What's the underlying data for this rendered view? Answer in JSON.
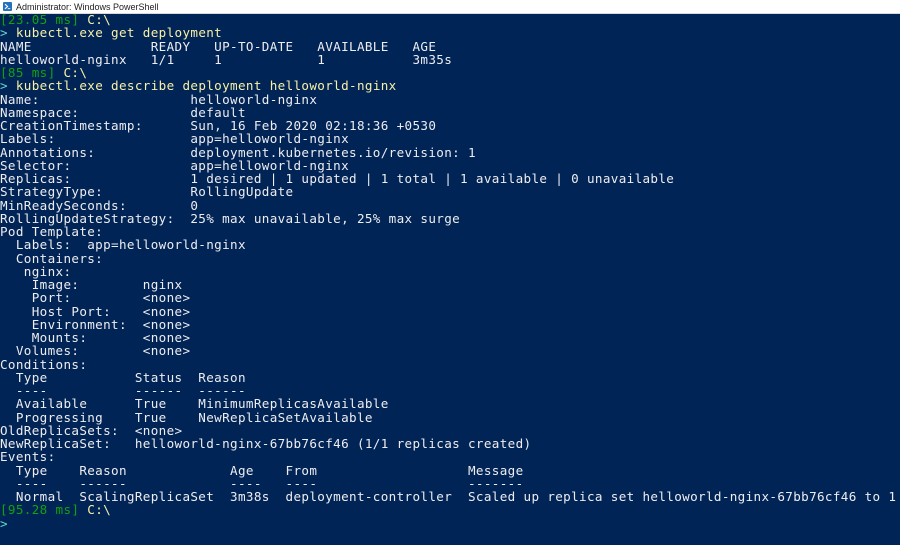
{
  "window": {
    "title": "Administrator: Windows PowerShell"
  },
  "colors": {
    "background": "#012456",
    "foreground": "#eeedf0",
    "timing": "#13a10e",
    "path": "#f9f1a5",
    "command": "#f9f1a5",
    "chevron": "#61d6d6"
  },
  "terminal": {
    "lines": [
      {
        "type": "prompt",
        "time": "[23.05 ms]",
        "path": "C:\\"
      },
      {
        "type": "command",
        "chevron": ">",
        "text": "kubectl.exe get deployment"
      },
      {
        "type": "output",
        "text": "NAME               READY   UP-TO-DATE   AVAILABLE   AGE"
      },
      {
        "type": "output",
        "text": "helloworld-nginx   1/1     1            1           3m35s"
      },
      {
        "type": "prompt",
        "time": "[85 ms]",
        "path": "C:\\"
      },
      {
        "type": "command",
        "chevron": ">",
        "text": "kubectl.exe describe deployment helloworld-nginx"
      },
      {
        "type": "output",
        "text": "Name:                   helloworld-nginx"
      },
      {
        "type": "output",
        "text": "Namespace:              default"
      },
      {
        "type": "output",
        "text": "CreationTimestamp:      Sun, 16 Feb 2020 02:18:36 +0530"
      },
      {
        "type": "output",
        "text": "Labels:                 app=helloworld-nginx"
      },
      {
        "type": "output",
        "text": "Annotations:            deployment.kubernetes.io/revision: 1"
      },
      {
        "type": "output",
        "text": "Selector:               app=helloworld-nginx"
      },
      {
        "type": "output",
        "text": "Replicas:               1 desired | 1 updated | 1 total | 1 available | 0 unavailable"
      },
      {
        "type": "output",
        "text": "StrategyType:           RollingUpdate"
      },
      {
        "type": "output",
        "text": "MinReadySeconds:        0"
      },
      {
        "type": "output",
        "text": "RollingUpdateStrategy:  25% max unavailable, 25% max surge"
      },
      {
        "type": "output",
        "text": "Pod Template:"
      },
      {
        "type": "output",
        "text": "  Labels:  app=helloworld-nginx"
      },
      {
        "type": "output",
        "text": "  Containers:"
      },
      {
        "type": "output",
        "text": "   nginx:"
      },
      {
        "type": "output",
        "text": "    Image:        nginx"
      },
      {
        "type": "output",
        "text": "    Port:         <none>"
      },
      {
        "type": "output",
        "text": "    Host Port:    <none>"
      },
      {
        "type": "output",
        "text": "    Environment:  <none>"
      },
      {
        "type": "output",
        "text": "    Mounts:       <none>"
      },
      {
        "type": "output",
        "text": "  Volumes:        <none>"
      },
      {
        "type": "output",
        "text": "Conditions:"
      },
      {
        "type": "output",
        "text": "  Type           Status  Reason"
      },
      {
        "type": "output",
        "text": "  ----           ------  ------"
      },
      {
        "type": "output",
        "text": "  Available      True    MinimumReplicasAvailable"
      },
      {
        "type": "output",
        "text": "  Progressing    True    NewReplicaSetAvailable"
      },
      {
        "type": "output",
        "text": "OldReplicaSets:  <none>"
      },
      {
        "type": "output",
        "text": "NewReplicaSet:   helloworld-nginx-67bb76cf46 (1/1 replicas created)"
      },
      {
        "type": "output",
        "text": "Events:"
      },
      {
        "type": "output",
        "text": "  Type    Reason             Age    From                   Message"
      },
      {
        "type": "output",
        "text": "  ----    ------             ----   ----                   -------"
      },
      {
        "type": "output",
        "text": "  Normal  ScalingReplicaSet  3m38s  deployment-controller  Scaled up replica set helloworld-nginx-67bb76cf46 to 1"
      },
      {
        "type": "prompt",
        "time": "[95.28 ms]",
        "path": "C:\\"
      },
      {
        "type": "command",
        "chevron": ">",
        "text": ""
      }
    ]
  }
}
